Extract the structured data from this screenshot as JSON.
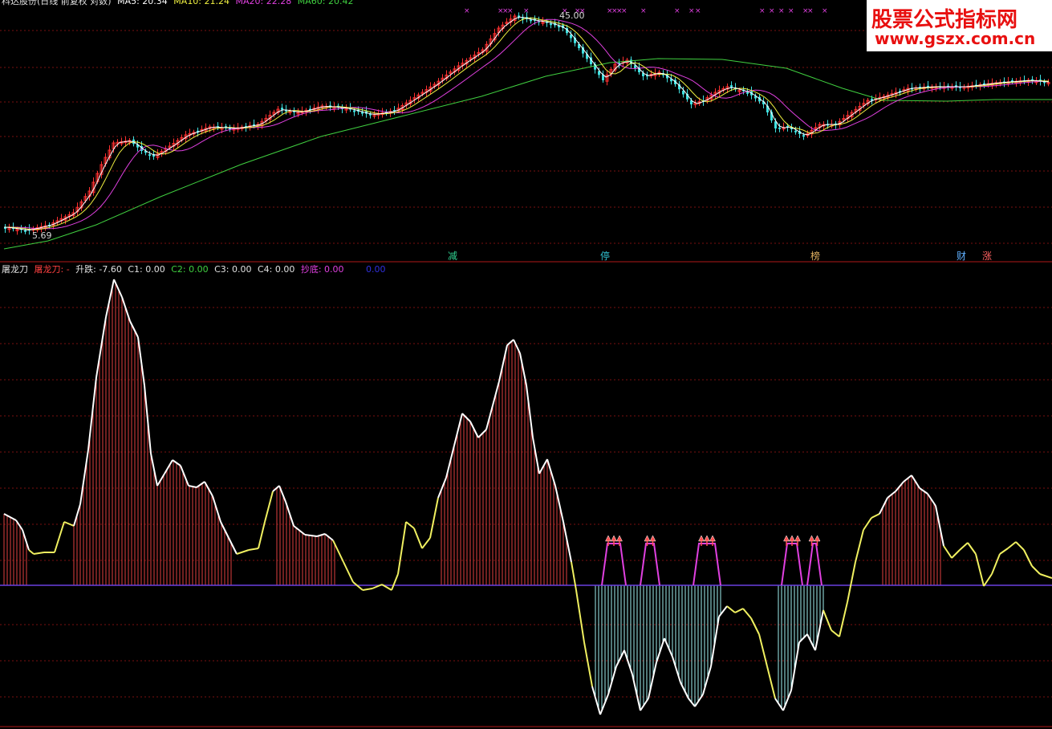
{
  "main_header": {
    "title": "科达股份(日线 前复权 对数)",
    "ma5": "MA5: 20.34",
    "ma10": "MA10: 21.24",
    "ma20": "MA20: 22.28",
    "ma60": "MA60: 20.42"
  },
  "price_labels": {
    "high": "45.00",
    "low": "5.69"
  },
  "signal_labels": [
    {
      "text": "减",
      "color": "#30d090"
    },
    {
      "text": "停",
      "color": "#30c0d0"
    },
    {
      "text": "榜",
      "color": "#e0b060"
    },
    {
      "text": "财",
      "color": "#60b0ff"
    },
    {
      "text": "涨",
      "color": "#ff6060"
    }
  ],
  "indicator_header": {
    "name": "屠龙刀",
    "line1": "屠龙刀: -",
    "rise_fall": "升跌: -7.60",
    "c1": "C1: 0.00",
    "c2": "C2: 0.00",
    "c3": "C3: 0.00",
    "c4": "C4: 0.00",
    "bottom": "抄底: 0.00",
    "extra": "0.00"
  },
  "colors": {
    "ma5": "#ffffff",
    "ma10": "#f0f040",
    "ma20": "#e040e0",
    "ma60": "#40d040",
    "up": "#ff3030",
    "down": "#40e0e0",
    "osc_white": "#ffffff",
    "osc_yellow": "#f0f060",
    "hist_red": "#e04040",
    "hist_cyan": "#a0f0f0",
    "signal": "#e040e0",
    "zero": "#6a40e0"
  },
  "watermark": {
    "title": "股票公式指标网",
    "url": "www.gszx.com.cn"
  }
}
